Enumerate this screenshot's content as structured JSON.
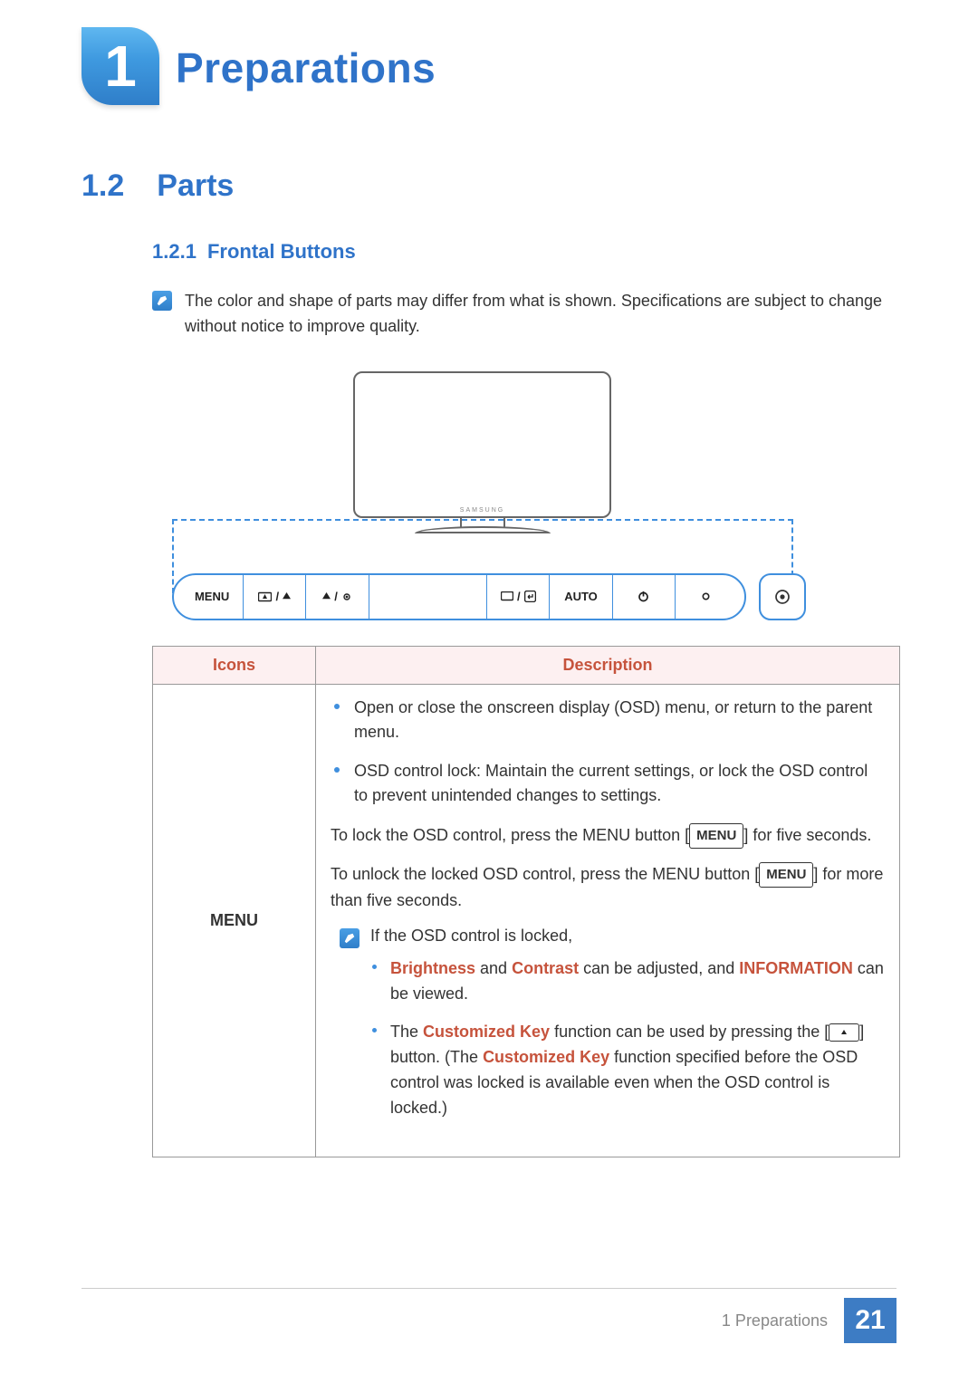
{
  "chapter": {
    "number": "1",
    "title": "Preparations"
  },
  "section": {
    "number": "1.2",
    "title": "Parts"
  },
  "subsection": {
    "number": "1.2.1",
    "title": "Frontal Buttons"
  },
  "note": {
    "text": "The color and shape of parts may differ from what is shown. Specifications are subject to change without notice to improve quality."
  },
  "monitor": {
    "brand": "SAMSUNG"
  },
  "button_bar": {
    "menu": "MENU",
    "auto": "AUTO"
  },
  "table": {
    "header_icons": "Icons",
    "header_desc": "Description",
    "menu_label": "MENU",
    "bullets": {
      "b1": "Open or close the onscreen display (OSD) menu, or return to the parent menu.",
      "b2": "OSD control lock: Maintain the current settings, or lock the OSD control to prevent unintended changes to settings."
    },
    "lock_p1a": "To lock the OSD control, press the MENU button [",
    "lock_p1b": "] for five seconds.",
    "unlock_p1a": "To unlock the locked OSD control, press the MENU button [",
    "unlock_p1b": "] for more than five seconds.",
    "inline_menu": "MENU",
    "locked_intro": "If the OSD control is locked,",
    "sub1": {
      "a": "Brightness",
      "b": " and ",
      "c": "Contrast",
      "d": " can be adjusted, and ",
      "e": "INFORMATION",
      "f": " can be viewed."
    },
    "sub2": {
      "a": "The ",
      "b": "Customized Key",
      "c": " function can be used by pressing the [",
      "d": "] button. (The ",
      "e": "Customized Key",
      "f": " function specified before the OSD control was locked is available even when the OSD control is locked.)"
    }
  },
  "footer": {
    "text": "1 Preparations",
    "page": "21"
  }
}
